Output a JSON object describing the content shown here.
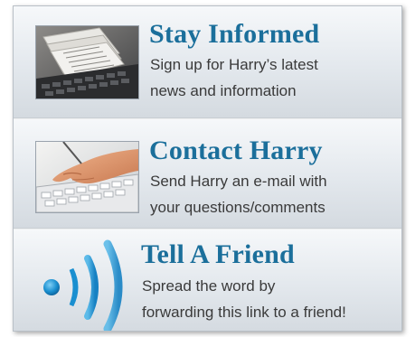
{
  "items": [
    {
      "title": "Stay Informed",
      "line1": "Sign up for Harry’s latest",
      "line2": "news and information",
      "icon": "newspaper-laptop-photo"
    },
    {
      "title": "Contact Harry",
      "line1": "Send Harry an e-mail with",
      "line2": "your questions/comments",
      "icon": "hand-typing-keyboard-photo"
    },
    {
      "title": "Tell A Friend",
      "line1": "Spread the word by",
      "line2": "forwarding this link to a friend!",
      "icon": "broadcast-signal-icon"
    }
  ],
  "colors": {
    "title": "#1b6f9b",
    "text": "#3a3a3a",
    "panel_bg": "#e7ebef",
    "signal_blue": "#1a8fd0"
  }
}
